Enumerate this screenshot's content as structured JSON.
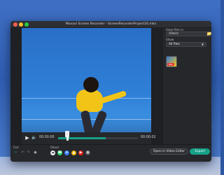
{
  "window": {
    "title": "Movavi Screen Recorder - ScreenRecorderProject16.mkv"
  },
  "player": {
    "time_current": "00:00:00",
    "time_total": "00:00:02",
    "trim_progress": 0.6
  },
  "panel": {
    "view_label": "View files in",
    "path": "/Users",
    "show_label": "Show",
    "filter": "All files",
    "thumb_tag": "REC"
  },
  "toolbar": {
    "cut_label": "Cut",
    "share_label": "Share",
    "open_editor_label": "Open in Video Editor",
    "export_label": "Export"
  },
  "colors": {
    "accent": "#16a086",
    "window_bg": "#26272b"
  },
  "icons": {
    "play": "play-icon",
    "volume": "volume-icon",
    "folder": "folder-icon",
    "scissors": "scissors-icon",
    "undo": "undo-icon",
    "redo": "redo-icon",
    "camera": "camera-icon"
  }
}
